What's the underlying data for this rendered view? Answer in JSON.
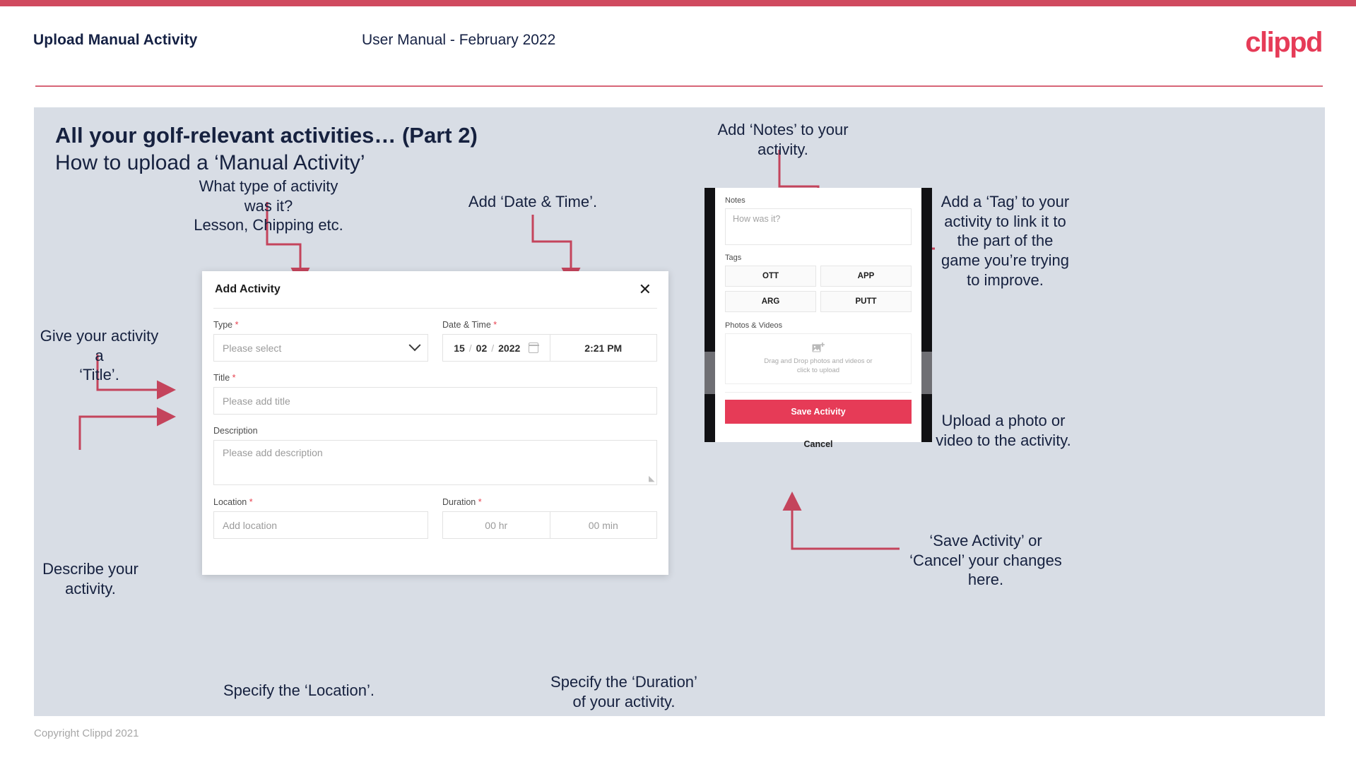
{
  "header": {
    "title": "Upload Manual Activity",
    "subtitle": "User Manual - February 2022",
    "logo": "clippd"
  },
  "slide": {
    "heading": "All your golf-relevant activities… (Part 2)",
    "subheading": "How to upload a ‘Manual Activity’"
  },
  "annotations": {
    "type": "What type of activity was it?\nLesson, Chipping etc.",
    "date_time": "Add ‘Date & Time’.",
    "title": "Give your activity a\n‘Title’.",
    "description": "Describe your\nactivity.",
    "location": "Specify the ‘Location’.",
    "duration": "Specify the ‘Duration’\nof your activity.",
    "notes": "Add ‘Notes’ to your\nactivity.",
    "tags": "Add a ‘Tag’ to your\nactivity to link it to\nthe part of the\ngame you’re trying\nto improve.",
    "photos": "Upload a photo or\nvideo to the activity.",
    "save_cancel": "‘Save Activity’ or\n‘Cancel’ your changes\nhere."
  },
  "modal": {
    "title": "Add Activity",
    "close_icon": "close-icon",
    "fields": {
      "type": {
        "label": "Type",
        "required": true,
        "placeholder": "Please select"
      },
      "date_time": {
        "label": "Date & Time",
        "required": true,
        "day": "15",
        "month": "02",
        "year": "2022",
        "time": "2:21 PM",
        "calendar_icon": "calendar-icon"
      },
      "title": {
        "label": "Title",
        "required": true,
        "placeholder": "Please add title"
      },
      "description": {
        "label": "Description",
        "required": false,
        "placeholder": "Please add description"
      },
      "location": {
        "label": "Location",
        "required": true,
        "placeholder": "Add location"
      },
      "duration": {
        "label": "Duration",
        "required": true,
        "hours": "00 hr",
        "minutes": "00 min"
      }
    }
  },
  "phone": {
    "notes": {
      "label": "Notes",
      "placeholder": "How was it?"
    },
    "tags": {
      "label": "Tags",
      "items": [
        "OTT",
        "APP",
        "ARG",
        "PUTT"
      ]
    },
    "photos": {
      "label": "Photos & Videos",
      "icon": "add-image-icon",
      "drop_text": "Drag and Drop photos and videos or\nclick to upload"
    },
    "save_label": "Save Activity",
    "cancel_label": "Cancel"
  },
  "footer": {
    "copyright": "Copyright Clippd 2021"
  },
  "colors": {
    "brand_pink": "#e63b57",
    "rule_red": "#d04a5f",
    "slide_bg": "#d8dde5",
    "navy_text": "#16213f",
    "arrow_red": "#c4445c"
  }
}
